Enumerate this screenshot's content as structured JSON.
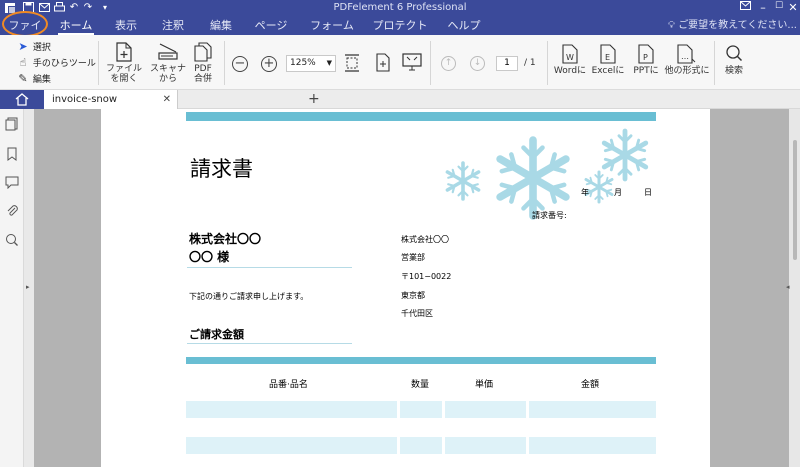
{
  "app_title": "PDFelement 6 Professional",
  "menu_tabs": [
    {
      "label": "ファイル"
    },
    {
      "label": "ホーム"
    },
    {
      "label": "表示"
    },
    {
      "label": "注釈"
    },
    {
      "label": "編集"
    },
    {
      "label": "ページ"
    },
    {
      "label": "フォーム"
    },
    {
      "label": "プロテクト"
    },
    {
      "label": "ヘルプ"
    }
  ],
  "active_tab": "ホーム",
  "help_search_placeholder": "ご要望を教えてください...",
  "ribbon": {
    "select_label": "選択",
    "hand_label": "手のひらツール",
    "edit_label": "編集",
    "open_label_1": "ファイル",
    "open_label_2": "を開く",
    "scan_label_1": "スキャナ",
    "scan_label_2": "から",
    "combine_label_1": "PDF",
    "combine_label_2": "合併",
    "zoom_value": "125%",
    "page_current": "1",
    "page_total": "/ 1",
    "to_word": "Wordに",
    "to_excel": "Excelに",
    "to_ppt": "PPTに",
    "to_other": "他の形式に",
    "search": "検索"
  },
  "document_tab": {
    "title": "invoice-snow"
  },
  "invoice": {
    "title": "請求書",
    "date_year": "年",
    "date_month": "月",
    "date_day": "日",
    "invoice_number_label": "請求番号:",
    "customer_company": "株式会社〇〇",
    "customer_name": "〇〇 様",
    "intro_text": "下記の通りご請求申し上げます。",
    "amount_label": "ご請求金額",
    "sender_company": "株式会社〇〇",
    "sender_department": "営業部",
    "sender_postal": "〒101−0022",
    "sender_city": "東京都",
    "sender_ward": "千代田区",
    "table_headers": [
      "品番·品名",
      "数量",
      "単価",
      "金額"
    ]
  },
  "colors": {
    "title_bar": "#3b4a9a",
    "accent_teal": "#69bed3",
    "row_fill": "#def2f8",
    "file_highlight": "#f08a24"
  }
}
